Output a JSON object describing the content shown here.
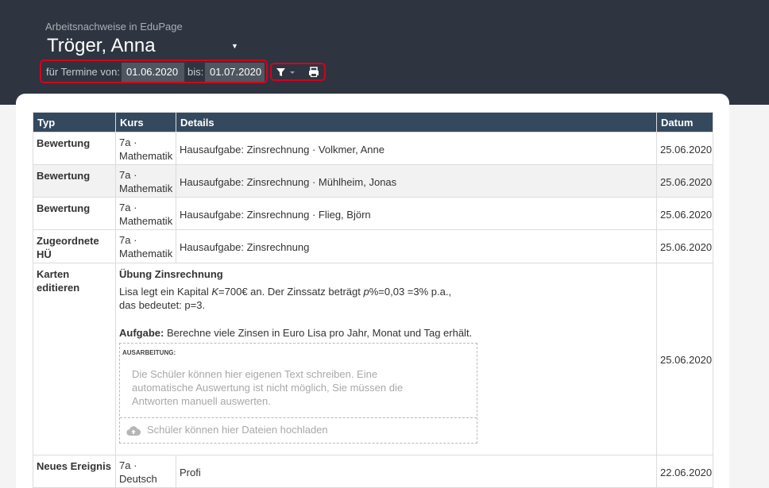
{
  "header": {
    "app_title": "Arbeitsnachweise in EduPage",
    "student_name": "Tröger, Anna",
    "name_dropdown_icon": "caret-down-icon",
    "from_label": "für Termine von:",
    "from_date": "01.06.2020",
    "to_label": "bis:",
    "to_date": "01.07.2020",
    "filter_icon": "filter-icon",
    "print_icon": "print-icon",
    "highlight_color": "#d6001c"
  },
  "table": {
    "columns": [
      "Typ",
      "Kurs",
      "Details",
      "Datum"
    ],
    "rows": [
      {
        "typ": "Bewertung",
        "kurs_class": "7a ·",
        "kurs_subject": "Mathematik",
        "details": "Hausaufgabe: Zinsrechnung · Volkmer, Anne",
        "datum": "25.06.2020"
      },
      {
        "typ": "Bewertung",
        "kurs_class": "7a ·",
        "kurs_subject": "Mathematik",
        "details": "Hausaufgabe: Zinsrechnung · Mühlheim, Jonas",
        "datum": "25.06.2020"
      },
      {
        "typ": "Bewertung",
        "kurs_class": "7a ·",
        "kurs_subject": "Mathematik",
        "details": "Hausaufgabe: Zinsrechnung · Flieg, Björn",
        "datum": "25.06.2020"
      },
      {
        "typ": "Zugeordnete HÜ",
        "kurs_class": "7a ·",
        "kurs_subject": "Mathematik",
        "details": "Hausaufgabe: Zinsrechnung",
        "datum": "25.06.2020"
      },
      {
        "typ": "Karten editieren",
        "task_title": "Übung Zinsrechnung",
        "task_text_1": "Lisa legt ein Kapital ",
        "task_text_k": "K",
        "task_text_2": "=700€ an. Der Zinssatz beträgt ",
        "task_text_p": "p",
        "task_text_3": "%=0,03 =3% p.a., das bedeutet: p=3.",
        "aufgabe_label": "Aufgabe:",
        "aufgabe_text": " Berechne viele Zinsen in Euro Lisa pro Jahr, Monat und Tag erhält.",
        "answer_label": "AUSARBEITUNG:",
        "answer_placeholder": "Die Schüler können hier eigenen Text schreiben. Eine automatische Auswertung ist nicht möglich, Sie müssen die Antworten manuell auswerten.",
        "upload_icon": "cloud-upload-icon",
        "upload_text": "Schüler können hier Dateien hochladen",
        "datum": "25.06.2020"
      },
      {
        "typ": "Neues Ereignis",
        "kurs_class": "7a ·",
        "kurs_subject": "Deutsch",
        "details": "Profi",
        "datum": "22.06.2020"
      }
    ]
  }
}
